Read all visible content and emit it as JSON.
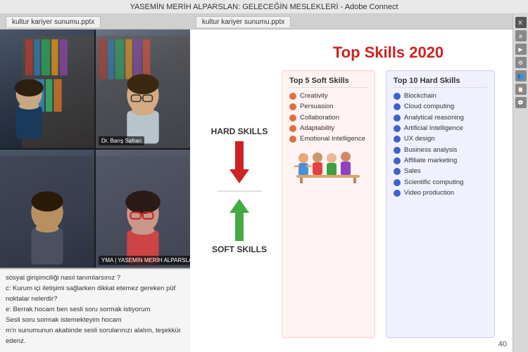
{
  "titleBar": {
    "text": "YASEMİN MERİH ALPARSLAN: GELECEĞİN MESLEKLERİ - Adobe Connect"
  },
  "fileTab": {
    "label": "kultur kariyer sunumu.pptx"
  },
  "videoParticipants": [
    {
      "id": "p1",
      "label": "",
      "description": "Woman with dark hair"
    },
    {
      "id": "p2",
      "label": "Dr. Barış Safran",
      "description": "Man with glasses"
    },
    {
      "id": "p3",
      "label": "",
      "description": "Man facing camera"
    },
    {
      "id": "p4",
      "label": "YMA | YASEMİN MERİH ALPARSLAN",
      "description": "Woman with red glasses"
    }
  ],
  "slide": {
    "title": "Top Skills 2020",
    "leftLabels": {
      "hard": "HARD\nSKILLS",
      "soft": "SOFT\nSKILLS"
    },
    "softSkillsColumn": {
      "title": "Top 5 Soft Skills",
      "items": [
        "Creativity",
        "Persuasion",
        "Collaboration",
        "Adaptability",
        "Emotional Intelligence"
      ]
    },
    "hardSkillsColumn": {
      "title": "Top 10 Hard Skills",
      "items": [
        "Blockchain",
        "Cloud computing",
        "Analytical reasoning",
        "Artificial Intelligence",
        "UX design",
        "Business analysis",
        "Affiliate marketing",
        "Sales",
        "Scientific computing",
        "Video production"
      ]
    },
    "slideNumber": "40"
  },
  "chat": {
    "lines": [
      {
        "text": "sosyal girişimciliği nasıl tanımlarsınız ?",
        "bold": false
      },
      {
        "text": "c: Kurum içi iletişimi sağlarken dikkat etemez gereken püf noktalar nelerdir?",
        "bold": false
      },
      {
        "text": "e: Berrak hocam ben sesli soru sormak istiyorum",
        "bold": false
      },
      {
        "text": "Sesli soru sormak istemekteyim hocam",
        "bold": false
      },
      {
        "text": "m'n sunumunun akabinde sesli sorularınızı alalım, teşekkür ederiz.",
        "bold": false
      }
    ]
  },
  "rightSidebar": {
    "icons": [
      "K",
      "a",
      "▶",
      "⚙",
      "👥",
      "📋",
      "💬"
    ]
  }
}
